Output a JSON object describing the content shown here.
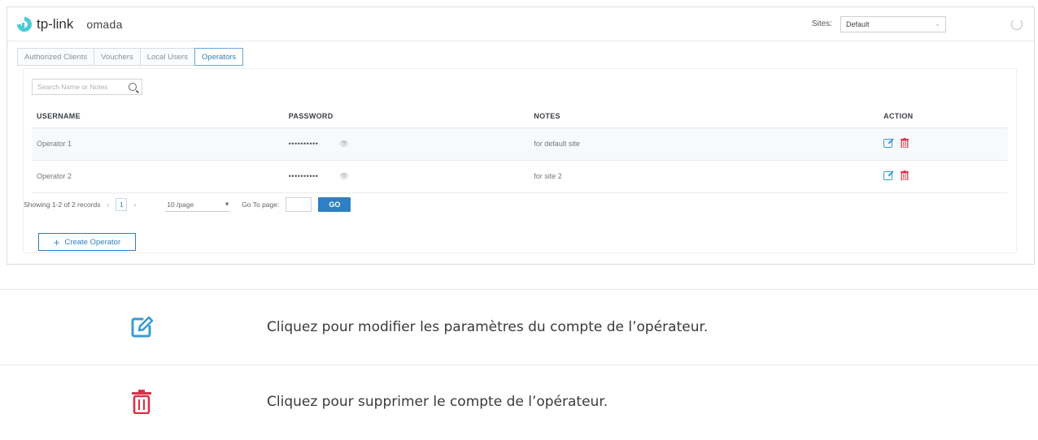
{
  "header": {
    "brand": "tp-link",
    "product": "omada",
    "sites_label": "Sites:",
    "sites_value": "Default"
  },
  "tabs": [
    {
      "label": "Authorized Clients",
      "active": false
    },
    {
      "label": "Vouchers",
      "active": false
    },
    {
      "label": "Local Users",
      "active": false
    },
    {
      "label": "Operators",
      "active": true
    }
  ],
  "search": {
    "placeholder": "Search Name or Notes"
  },
  "table": {
    "headers": [
      "USERNAME",
      "PASSWORD",
      "NOTES",
      "ACTION"
    ],
    "rows": [
      {
        "username": "Operator 1",
        "password": "••••••••••",
        "notes": "for default site"
      },
      {
        "username": "Operator 2",
        "password": "••••••••••",
        "notes": "for site 2"
      }
    ]
  },
  "pagination": {
    "summary": "Showing 1-2 of 2 records",
    "current_page": "1",
    "per_page": "10 /page",
    "goto_label": "Go To page:",
    "go_label": "GO"
  },
  "create_button": {
    "label": "Create Operator"
  },
  "legend": [
    {
      "icon": "edit-icon",
      "text": "Cliquez pour modifier les paramètres du compte de l’opérateur."
    },
    {
      "icon": "trash-icon",
      "text": "Cliquez pour supprimer le compte de l’opérateur."
    }
  ],
  "colors": {
    "accent": "#2f7fc4",
    "edit": "#3a9bd5",
    "delete": "#d6334a"
  }
}
